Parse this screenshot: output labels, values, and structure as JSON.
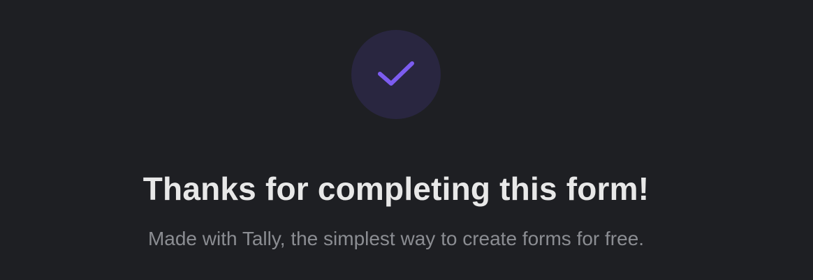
{
  "success": {
    "icon": "checkmark-icon",
    "title": "Thanks for completing this form!",
    "subtitle": "Made with Tally, the simplest way to create forms for free."
  },
  "colors": {
    "background": "#1e1f23",
    "badge_background": "#292640",
    "accent": "#7c5cf0",
    "title_text": "#e8e8e8",
    "subtitle_text": "#8b8d92"
  }
}
